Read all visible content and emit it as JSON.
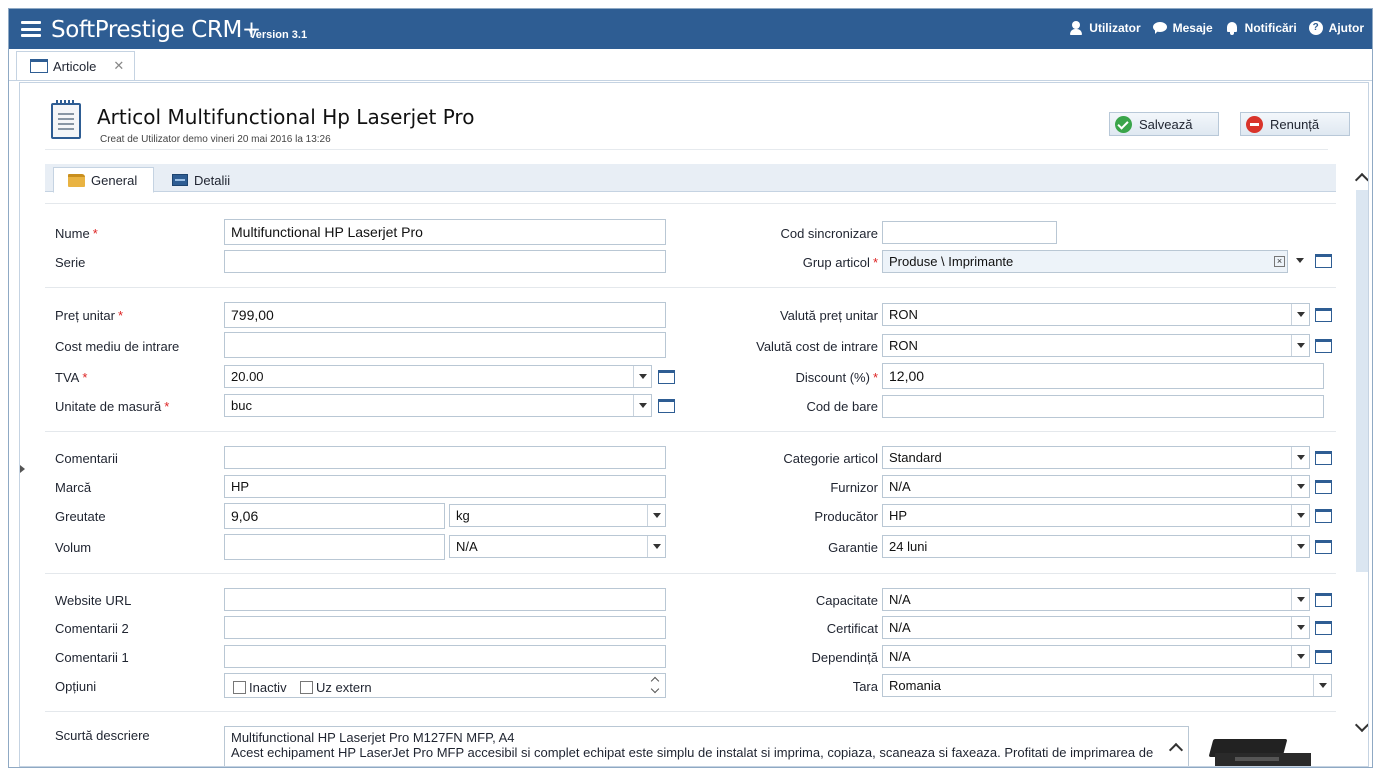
{
  "app": {
    "title": "SoftPrestige CRM+",
    "version": "Version 3.1",
    "nav": [
      "Utilizator",
      "Mesaje",
      "Notificări",
      "Ajutor"
    ]
  },
  "tab": {
    "label": "Articole",
    "close": "✕"
  },
  "header": {
    "title": "Articol Multifunctional Hp Laserjet Pro",
    "subtitle": "Creat de Utilizator demo vineri 20 mai 2016 la 13:26",
    "save": "Salvează",
    "cancel": "Renunță"
  },
  "form_tabs": [
    "General",
    "Detalii"
  ],
  "labels": {
    "nume": "Nume",
    "serie": "Serie",
    "cod_sincronizare": "Cod sincronizare",
    "grup_articol": "Grup articol",
    "pret_unitar": "Preț unitar",
    "cost_mediu": "Cost mediu de intrare",
    "tva": "TVA",
    "unitate": "Unitate de masură",
    "valuta_pret": "Valută preț unitar",
    "valuta_cost": "Valută cost de intrare",
    "discount": "Discount (%)",
    "cod_bare": "Cod de bare",
    "comentarii": "Comentarii",
    "marca": "Marcă",
    "greutate": "Greutate",
    "volum": "Volum",
    "categorie": "Categorie articol",
    "furnizor": "Furnizor",
    "producator": "Producător",
    "garantie": "Garantie",
    "website": "Website URL",
    "comentarii2": "Comentarii 2",
    "comentarii1": "Comentarii 1",
    "optiuni": "Opțiuni",
    "capacitate": "Capacitate",
    "certificat": "Certificat",
    "dependinta": "Dependință",
    "tara": "Tara",
    "scurta": "Scurtă descriere"
  },
  "required_mark": "*",
  "values": {
    "nume": "Multifunctional HP Laserjet Pro",
    "serie": "",
    "cod_sincronizare": "",
    "grup_articol": "Produse \\ Imprimante",
    "pret_unitar": "799,00",
    "cost_mediu": "",
    "tva": "20.00",
    "unitate": "buc",
    "valuta_pret": "RON",
    "valuta_cost": "RON",
    "discount": "12,00",
    "cod_bare": "",
    "comentarii": "",
    "marca": "HP",
    "greutate": "9,06",
    "greutate_unit": "kg",
    "volum": "",
    "volum_unit": "N/A",
    "categorie": "Standard",
    "furnizor": "N/A",
    "producator": "HP",
    "garantie": "24 luni",
    "website": "",
    "comentarii2": "",
    "comentarii1": "",
    "capacitate": "N/A",
    "certificat": "N/A",
    "dependinta": "N/A",
    "tara": "Romania",
    "opt_inactiv": "Inactiv",
    "opt_uz_extern": "Uz extern",
    "scurta_line1": "Multifunctional HP Laserjet Pro M127FN MFP, A4",
    "scurta_line2": "Acest echipament HP LaserJet Pro MFP accesibil si complet echipat este simplu de instalat si imprima, copiaza, scaneaza si faxeaza. Profitati de imprimarea de"
  },
  "colors": {
    "topbar": "#2e5d93",
    "required": "#dd2222",
    "accent": "#2e5d93"
  }
}
